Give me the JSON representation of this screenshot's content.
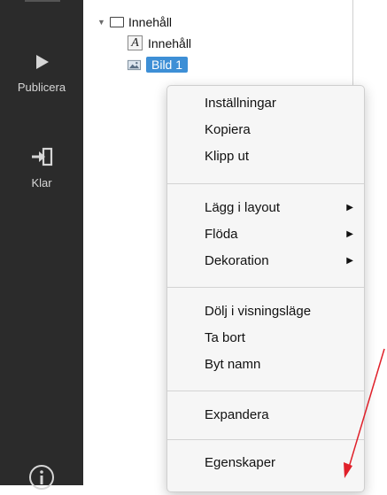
{
  "sidebar": {
    "publish_label": "Publicera",
    "done_label": "Klar"
  },
  "tree": {
    "root_label": "Innehåll",
    "children": [
      {
        "label": "Innehåll",
        "icon": "text-frame-icon"
      },
      {
        "label": "Bild 1",
        "icon": "image-icon",
        "selected": true
      }
    ]
  },
  "context_menu": {
    "items": [
      {
        "label": "Inställningar"
      },
      {
        "label": "Kopiera"
      },
      {
        "label": "Klipp ut"
      },
      {
        "label": "Lägg i layout",
        "submenu": true
      },
      {
        "label": "Flöda",
        "submenu": true
      },
      {
        "label": "Dekoration",
        "submenu": true
      },
      {
        "label": "Dölj i visningsläge"
      },
      {
        "label": "Ta bort"
      },
      {
        "label": "Byt namn"
      },
      {
        "label": "Expandera"
      },
      {
        "label": "Egenskaper"
      }
    ],
    "submenu_arrow": "▶"
  },
  "colors": {
    "sidebar_bg": "#2b2b2b",
    "selection": "#3d8fd6",
    "annotation_arrow": "#e0202a"
  }
}
